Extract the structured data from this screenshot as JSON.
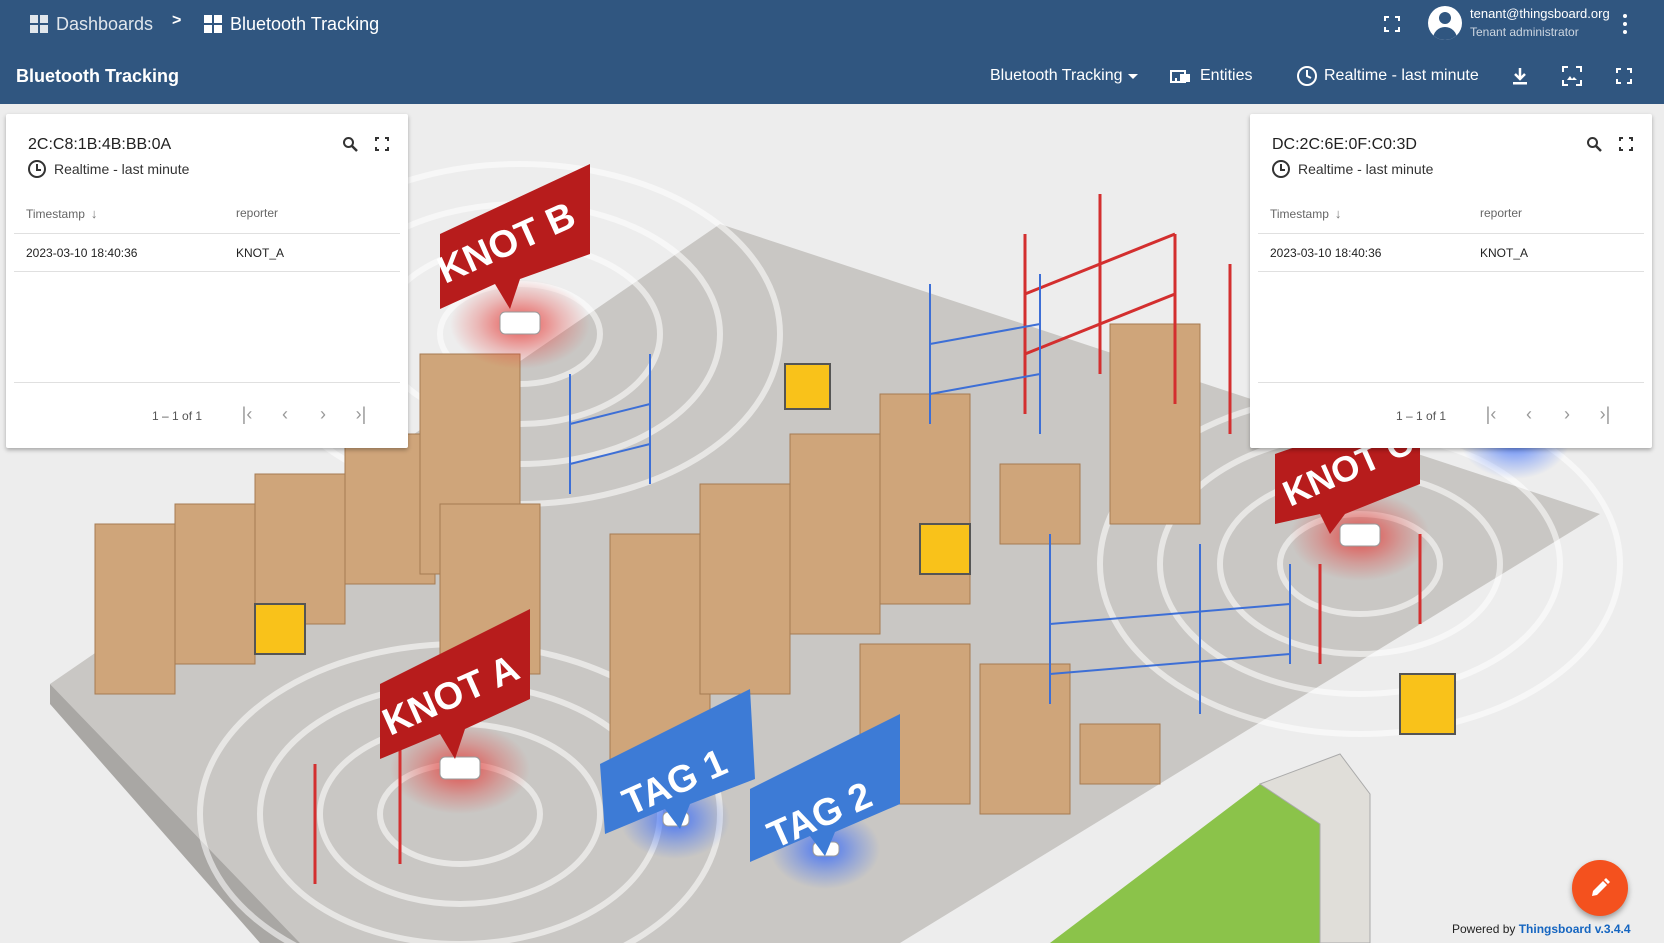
{
  "breadcrumb": [
    {
      "label": "Dashboards"
    },
    {
      "label": "Bluetooth Tracking"
    }
  ],
  "breadcrumb_separator": ">",
  "user": {
    "email": "tenant@thingsboard.org",
    "role": "Tenant administrator"
  },
  "toolbar": {
    "title": "Bluetooth Tracking",
    "state_select": "Bluetooth Tracking",
    "entities_label": "Entities",
    "timewindow_label": "Realtime - last minute"
  },
  "map_labels": {
    "knot_b": "KNOT B",
    "knot_a": "KNOT A",
    "knot_c": "KNOT C",
    "tag_1": "TAG 1",
    "tag_2": "TAG 2"
  },
  "widgets": [
    {
      "title": "2C:C8:1B:4B:BB:0A",
      "timewindow": "Realtime - last minute",
      "columns": [
        "Timestamp",
        "reporter"
      ],
      "rows": [
        [
          "2023-03-10 18:40:36",
          "KNOT_A"
        ]
      ],
      "range": "1 – 1 of 1"
    },
    {
      "title": "DC:2C:6E:0F:C0:3D",
      "timewindow": "Realtime - last minute",
      "columns": [
        "Timestamp",
        "reporter"
      ],
      "rows": [
        [
          "2023-03-10 18:40:36",
          "KNOT_A"
        ]
      ],
      "range": "1 – 1 of 1"
    }
  ],
  "footer": {
    "powered_by": "Powered by",
    "brand": "Thingsboard v.3.4.4"
  },
  "colors": {
    "primary": "#305680",
    "fab": "#f4511e",
    "knot": "#b71c1c",
    "tag": "#3d7bd6"
  },
  "icons": [
    "dashboard-icon",
    "fullscreen-icon",
    "account-icon",
    "more-vert-icon",
    "entities-icon",
    "clock-icon",
    "download-icon",
    "image-export-icon",
    "search-icon",
    "edit-icon"
  ]
}
